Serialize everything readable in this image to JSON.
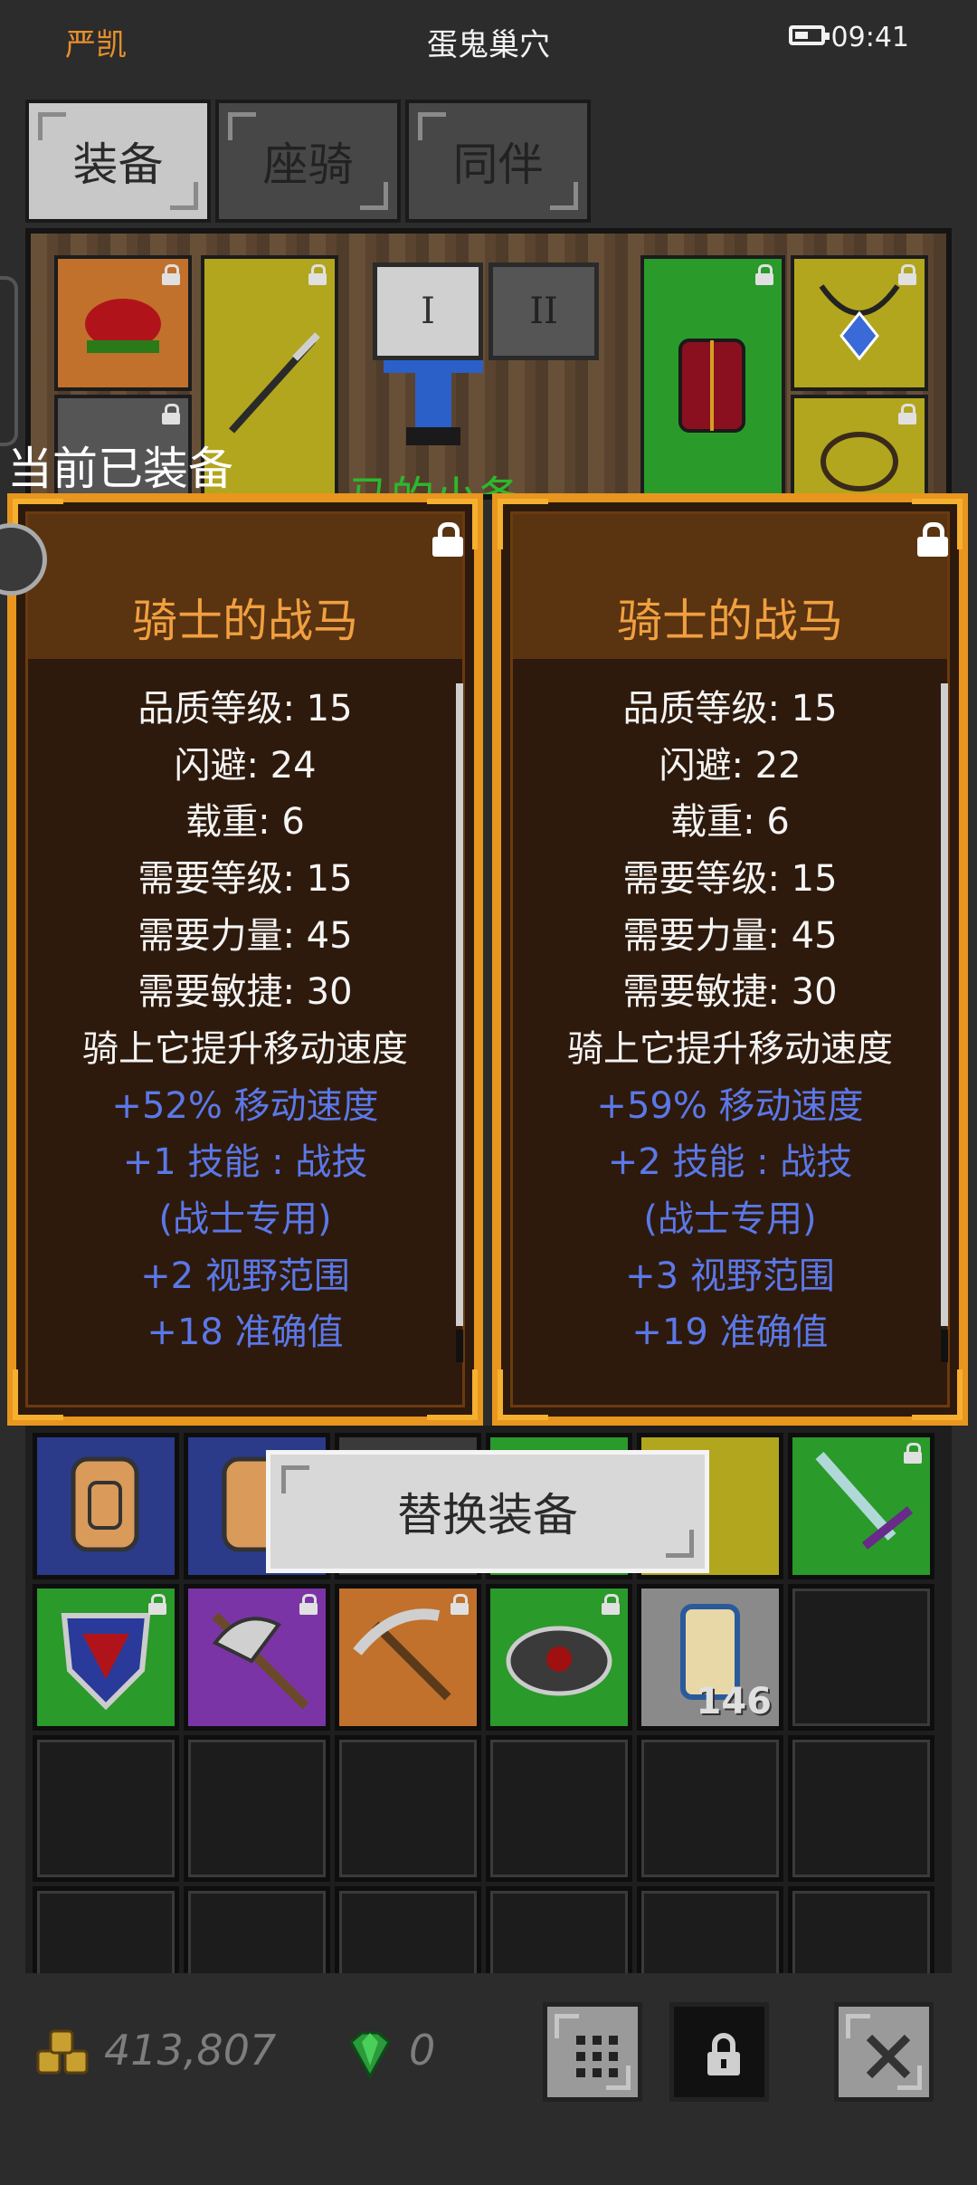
{
  "status_bar": {
    "left_label": "严凯",
    "title": "蛋鬼巢穴",
    "time": "09:41"
  },
  "tabs": [
    {
      "label": "装备",
      "active": true
    },
    {
      "label": "座骑",
      "active": false
    },
    {
      "label": "同伴",
      "active": false
    }
  ],
  "equipment_panel": {
    "page_buttons": [
      "I",
      "II"
    ],
    "overlay_text": "马的小备"
  },
  "equipped_label": "当前已装备",
  "cards": [
    {
      "title": "骑士的战马",
      "stats_white": [
        "品质等级: 15",
        "闪避: 24",
        "载重: 6",
        "需要等级: 15",
        "需要力量: 45",
        "需要敏捷: 30",
        "骑上它提升移动速度"
      ],
      "stats_blue": [
        "+52% 移动速度",
        "+1 技能 : 战技",
        "(战士专用)",
        "+2 视野范围",
        "+18 准确值"
      ]
    },
    {
      "title": "骑士的战马",
      "stats_white": [
        "品质等级: 15",
        "闪避: 22",
        "载重: 6",
        "需要等级: 15",
        "需要力量: 45",
        "需要敏捷: 30",
        "骑上它提升移动速度"
      ],
      "stats_blue": [
        "+59% 移动速度",
        "+2 技能 : 战技",
        "(战士专用)",
        "+3 视野范围",
        "+19 准确值"
      ]
    }
  ],
  "replace_button": "替换装备",
  "inventory": {
    "scroll_qty": "146"
  },
  "bottom_bar": {
    "gold": "413,807",
    "gems": "0"
  },
  "colors": {
    "card_border": "#e8961e",
    "stat_blue": "#5b78e8",
    "title_orange": "#f0a040"
  }
}
